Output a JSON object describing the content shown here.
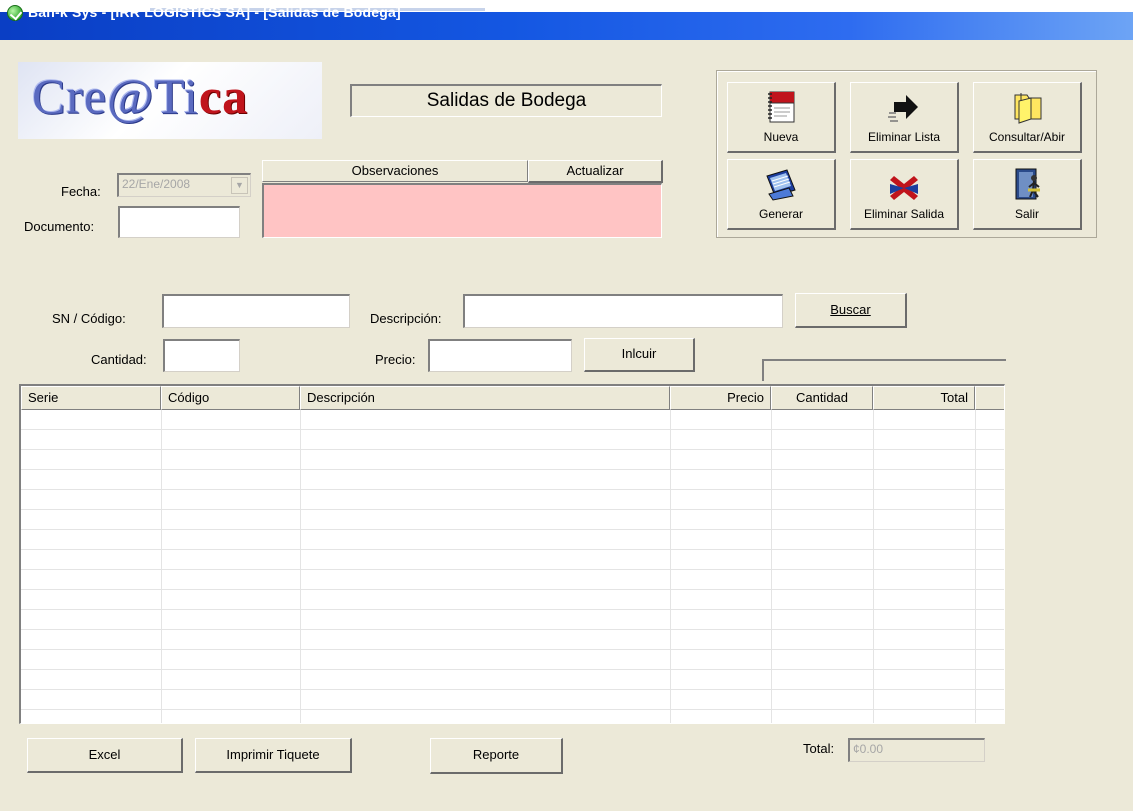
{
  "window": {
    "title": "Ban-k Sys - [IRR LOGISTICS SA] - [Salidas de Bodega]"
  },
  "logo": {
    "text_main": "Cre@Ti",
    "text_accent": "ca"
  },
  "header": {
    "title": "Salidas de Bodega"
  },
  "form": {
    "fecha_label": "Fecha:",
    "fecha_value": "22/Ene/2008",
    "documento_label": "Documento:",
    "documento_value": "",
    "observaciones_label": "Observaciones",
    "actualizar_label": "Actualizar",
    "observaciones_value": ""
  },
  "toolbar": {
    "nueva": "Nueva",
    "eliminar_lista": "Eliminar Lista",
    "consultar_abrir": "Consultar/Abir",
    "generar": "Generar",
    "eliminar_salida": "Eliminar Salida",
    "salir": "Salir"
  },
  "search": {
    "sn_codigo_label": "SN / Código:",
    "sn_codigo_value": "",
    "descripcion_label": "Descripción:",
    "descripcion_value": "",
    "buscar_label": "Buscar",
    "cantidad_label": "Cantidad:",
    "cantidad_value": "",
    "precio_label": "Precio:",
    "precio_value": "",
    "incluir_label": "Inlcuir"
  },
  "grid": {
    "columns": [
      "Serie",
      "Código",
      "Descripción",
      "Precio",
      "Cantidad",
      "Total"
    ],
    "rows": []
  },
  "footer": {
    "excel_label": "Excel",
    "imprimir_label": "Imprimir Tiquete",
    "reporte_label": "Reporte",
    "total_label": "Total:",
    "total_value": "¢0.00"
  },
  "colors": {
    "window_bg": "#ece9d8",
    "title_bar": "#0a3ec4",
    "observaciones_bg": "#ffc4c4"
  }
}
